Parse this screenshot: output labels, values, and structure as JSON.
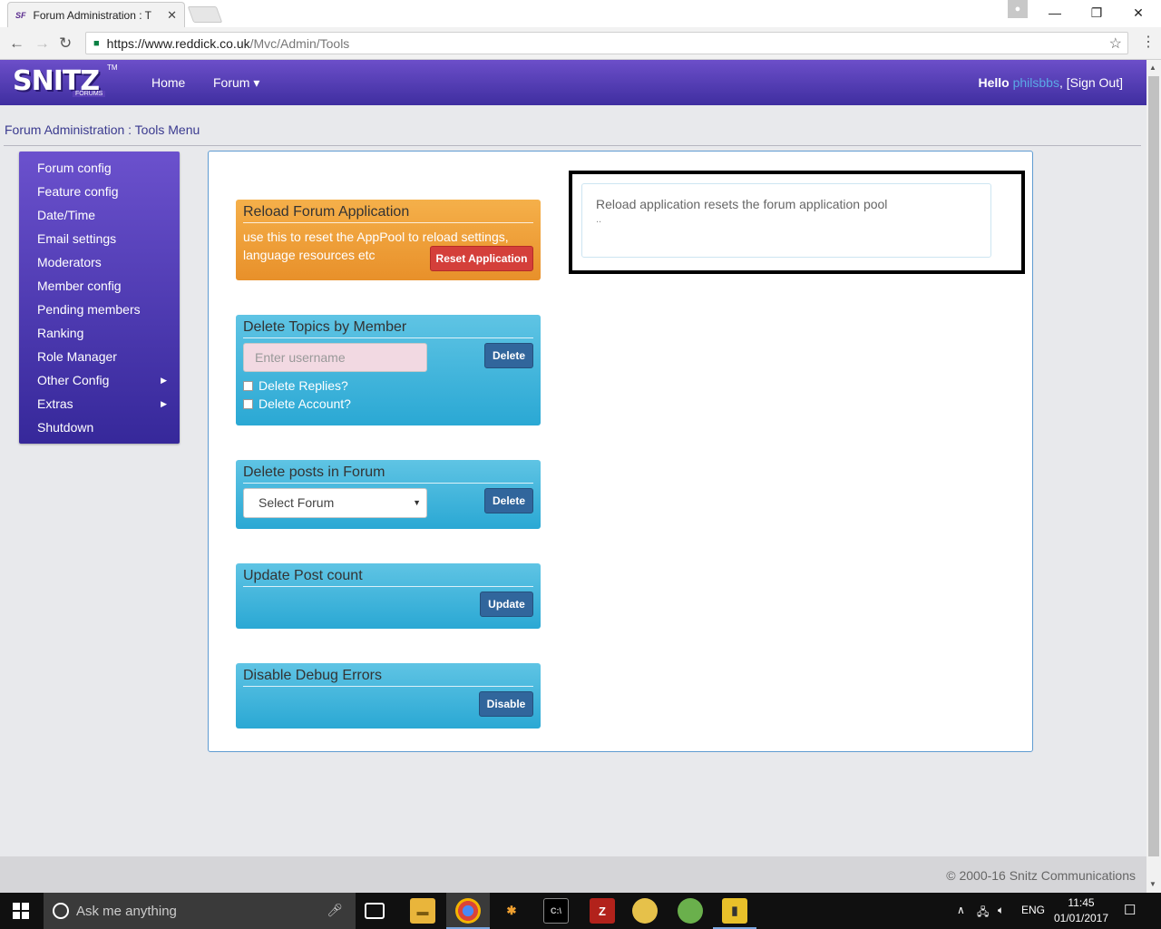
{
  "browser": {
    "tab_title": "Forum Administration : T",
    "tab_favicon": "SF",
    "url_host": "https://www.reddick.co.uk",
    "url_path": "/Mvc/Admin/Tools"
  },
  "navbar": {
    "logo_text": "SNITZ",
    "logo_sub": "FORUMS",
    "logo_tm": "TM",
    "links": [
      "Home",
      "Forum ▾"
    ],
    "hello_prefix": "Hello ",
    "username": "philsbbs",
    "signout": ", [Sign Out]"
  },
  "breadcrumb": "Forum Administration : Tools Menu",
  "sidebar": {
    "items": [
      {
        "label": "Forum config"
      },
      {
        "label": "Feature config"
      },
      {
        "label": "Date/Time"
      },
      {
        "label": "Email settings"
      },
      {
        "label": "Moderators"
      },
      {
        "label": "Member config"
      },
      {
        "label": "Pending members"
      },
      {
        "label": "Ranking"
      },
      {
        "label": "Role Manager"
      },
      {
        "label": "Other Config"
      },
      {
        "label": "Extras"
      },
      {
        "label": "Shutdown"
      }
    ]
  },
  "cards": {
    "reload": {
      "title": "Reload Forum Application",
      "desc": "use this to reset the AppPool to reload settings, language resources etc",
      "button": "Reset Application"
    },
    "delete_topics": {
      "title": "Delete Topics by Member",
      "placeholder": "Enter username",
      "button": "Delete",
      "check_replies": "Delete Replies?",
      "check_account": "Delete Account?"
    },
    "delete_posts": {
      "title": "Delete posts in Forum",
      "select_value": "Select Forum",
      "button": "Delete"
    },
    "update_count": {
      "title": "Update Post count",
      "button": "Update"
    },
    "debug": {
      "title": "Disable Debug Errors",
      "button": "Disable"
    }
  },
  "info": {
    "text": "Reload application resets the forum application pool",
    "dots": ".."
  },
  "footer": "© 2000-16 Snitz Communications",
  "taskbar": {
    "search_placeholder": "Ask me anything",
    "lang": "ENG",
    "time": "11:45",
    "date": "01/01/2017"
  },
  "colors": {
    "navbar": "#4b37b0",
    "card_orange": "#ef9f37",
    "card_blue": "#3bb3dc",
    "button_red": "#d43f3a",
    "button_blue": "#31669c"
  }
}
